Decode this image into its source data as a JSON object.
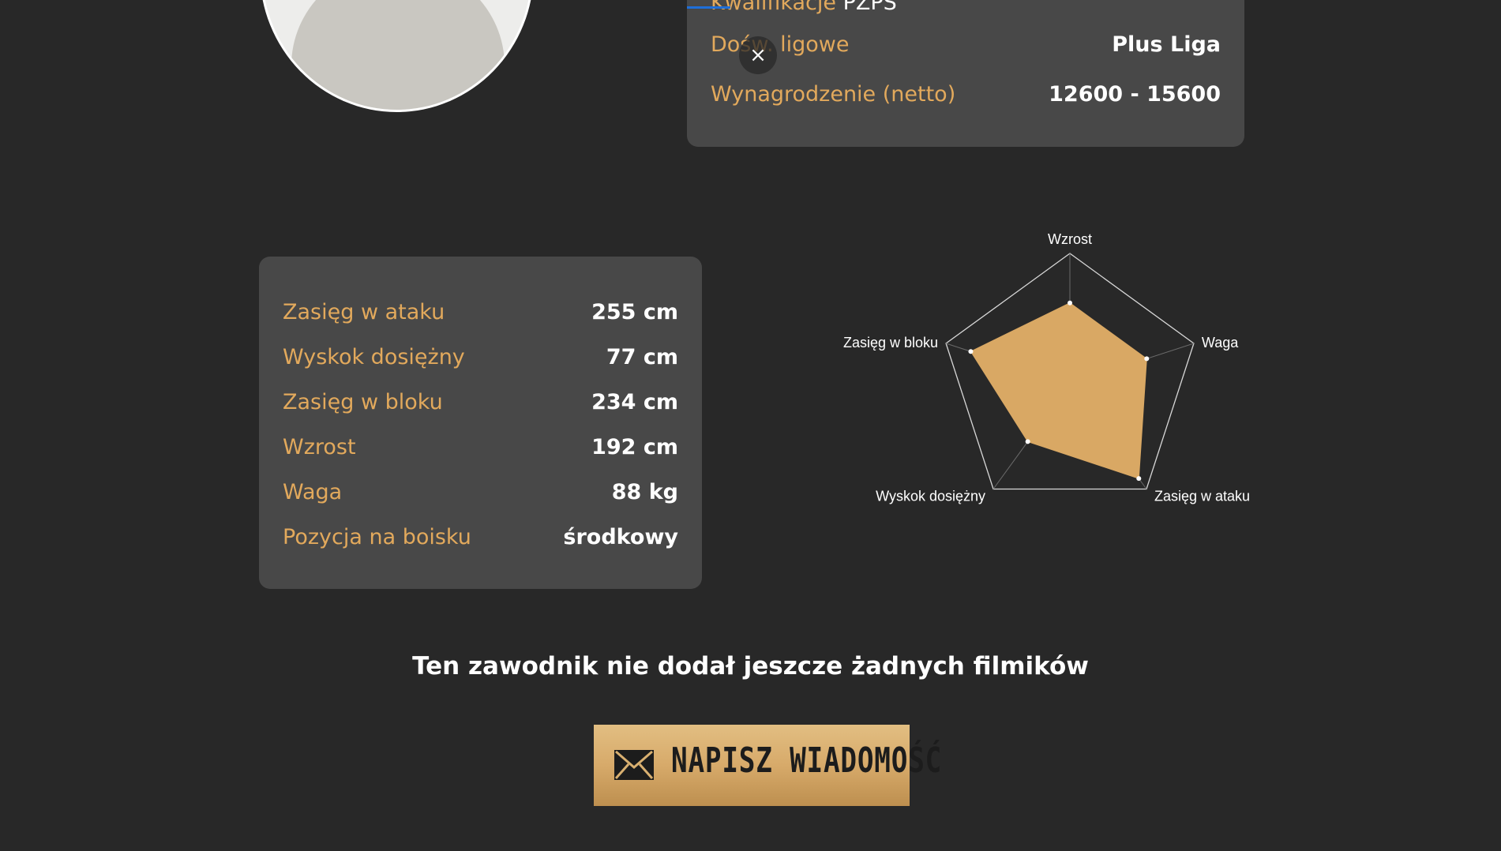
{
  "profile": {
    "info": {
      "partial_row": {
        "label": "Kwalifikacje",
        "value": "PZPS"
      },
      "rows": [
        {
          "label": "Dośw. ligowe",
          "value": "Plus Liga"
        },
        {
          "label": "Wynagrodzenie (netto)",
          "value": "12600 - 15600"
        }
      ]
    },
    "close_label": "×",
    "stats": [
      {
        "label": "Zasięg w ataku",
        "value": "255 cm"
      },
      {
        "label": "Wyskok dosiężny",
        "value": "77 cm"
      },
      {
        "label": "Zasięg w bloku",
        "value": "234 cm"
      },
      {
        "label": "Wzrost",
        "value": "192 cm"
      },
      {
        "label": "Waga",
        "value": "88 kg"
      },
      {
        "label": "Pozycja na boisku",
        "value": "środkowy"
      }
    ],
    "no_videos_text": "Ten zawodnik nie dodał jeszcze żadnych filmików",
    "message_button_label": "NAPISZ WIADOMOŚĆ"
  },
  "colors": {
    "background": "#282828",
    "card": "#484848",
    "label": "#e2a95c",
    "radar_fill": "#d9a864"
  },
  "icons": {
    "close": "close-icon",
    "message": "envelope-icon"
  },
  "chart_data": {
    "type": "radar",
    "axes": [
      "Wzrost",
      "Waga",
      "Zasięg w ataku",
      "Wyskok dosiężny",
      "Zasięg w bloku"
    ],
    "values": [
      0.62,
      0.62,
      0.9,
      0.55,
      0.8
    ],
    "max": 1,
    "grid": false,
    "fill_color": "#d9a864"
  }
}
